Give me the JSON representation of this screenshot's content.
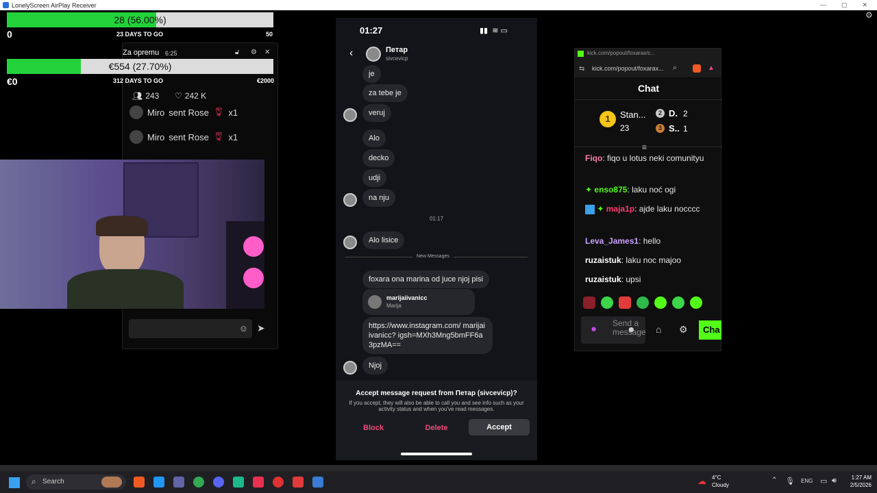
{
  "window": {
    "title": "LonelyScreen AirPlay Receiver"
  },
  "goal1": {
    "label": "28 (56.00%)",
    "progress": 0.56,
    "min": "0",
    "days": "23 DAYS TO GO",
    "max": "50"
  },
  "goal2": {
    "label": "€554 (27.70%)",
    "progress": 0.277,
    "min": "€0",
    "days": "312 DAYS TO GO",
    "max": "€2000"
  },
  "live": {
    "title": "Za opremu",
    "timer": "6:25",
    "viewers": "243",
    "likes": "242 K",
    "gifts": [
      {
        "user": "Miro",
        "text": "sent Rose",
        "count": "x1"
      },
      {
        "user": "Miro",
        "text": "sent Rose",
        "count": "x1"
      }
    ]
  },
  "phone": {
    "time": "01:27",
    "contact_name": "Петар",
    "contact_handle": "sivcevicp",
    "messages": [
      "je",
      "za tebe je",
      "veruj",
      "Alo",
      "decko",
      "udji",
      "na nju"
    ],
    "timestamp": "01:17",
    "msg_alo": "Alo lisice",
    "new_label": "New Messages",
    "msg_foxara": "foxara ona marina od juce njoj pisi",
    "share_name": "marijaiivanicc",
    "share_sub": "Marija",
    "link": "https://www.instagram.com/ marijaiivanicc? igsh=MXh3Mng5bmFF6a3pzMA==",
    "msg_njoj": "Njoj",
    "request_title": "Accept message request from Петар (sivcevicp)?",
    "request_body": "If you accept, they will also be able to call you and see info such as your activity status and when you've read messages.",
    "block": "Block",
    "delete": "Delete",
    "accept": "Accept"
  },
  "kick": {
    "url_title": "kick.com/popout/foxarax/c...",
    "url": "kick.com/popout/foxarax...",
    "chat_title": "Chat",
    "lb": [
      {
        "rank": "1",
        "name": "Stan...",
        "score": "23"
      },
      {
        "rank": "2",
        "name": "D.",
        "score": "2"
      },
      {
        "rank": "3",
        "name": "S..",
        "score": "1"
      }
    ],
    "messages": [
      {
        "user": "Fiqo",
        "text": ": fiqo u lotus neki comunityu",
        "color": "#ff7ea6"
      },
      {
        "user": "enso875",
        "text": ": laku noć ogi",
        "color": "#53fc18"
      },
      {
        "user": "maja1p",
        "text": ": ajde laku nocccc",
        "color": "#ff3d6e"
      },
      {
        "user": "Leva_James1",
        "text": ": hello",
        "color": "#c9a2ff"
      },
      {
        "user": "ruzaistuk",
        "text": ": laku noc majoo",
        "color": "#ffffff"
      },
      {
        "user": "ruzaistuk",
        "text": ": upsi",
        "color": "#ffffff"
      }
    ],
    "input_placeholder": "Send a message",
    "send_label": "Cha"
  },
  "taskbar": {
    "search": "Search",
    "temp": "4°C",
    "weather": "Cloudy",
    "lang": "ENG",
    "time": "1:27 AM",
    "date": "2/5/2026"
  },
  "colors": {
    "green": "#23d23b",
    "kick": "#53fc18",
    "accept": "#3a3b40",
    "pink": "#f0497b"
  }
}
